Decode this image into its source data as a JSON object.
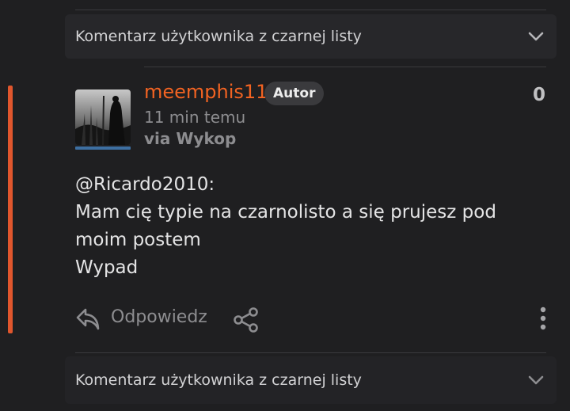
{
  "top_collapsed": {
    "label": "Komentarz użytkownika z czarnej listy"
  },
  "comment": {
    "username": "meemphis11",
    "author_badge": "Autor",
    "time_ago": "11 min temu",
    "via": "via Wykop",
    "votes": "0",
    "lines": [
      "@Ricardo2010:",
      "Mam cię typie na czarnolisto a się prujesz pod",
      "moim postem",
      "Wypad"
    ],
    "reply_label": "Odpowiedz",
    "icons": {
      "reply": "reply-arrow-icon",
      "share": "share-icon",
      "more": "more-vertical-icon"
    }
  },
  "bottom_collapsed": {
    "label": "Komentarz użytkownika z czarnej listy"
  },
  "colors": {
    "accent": "#e0562d",
    "username": "#f26322",
    "avatar_underline": "#3d6fa1"
  }
}
